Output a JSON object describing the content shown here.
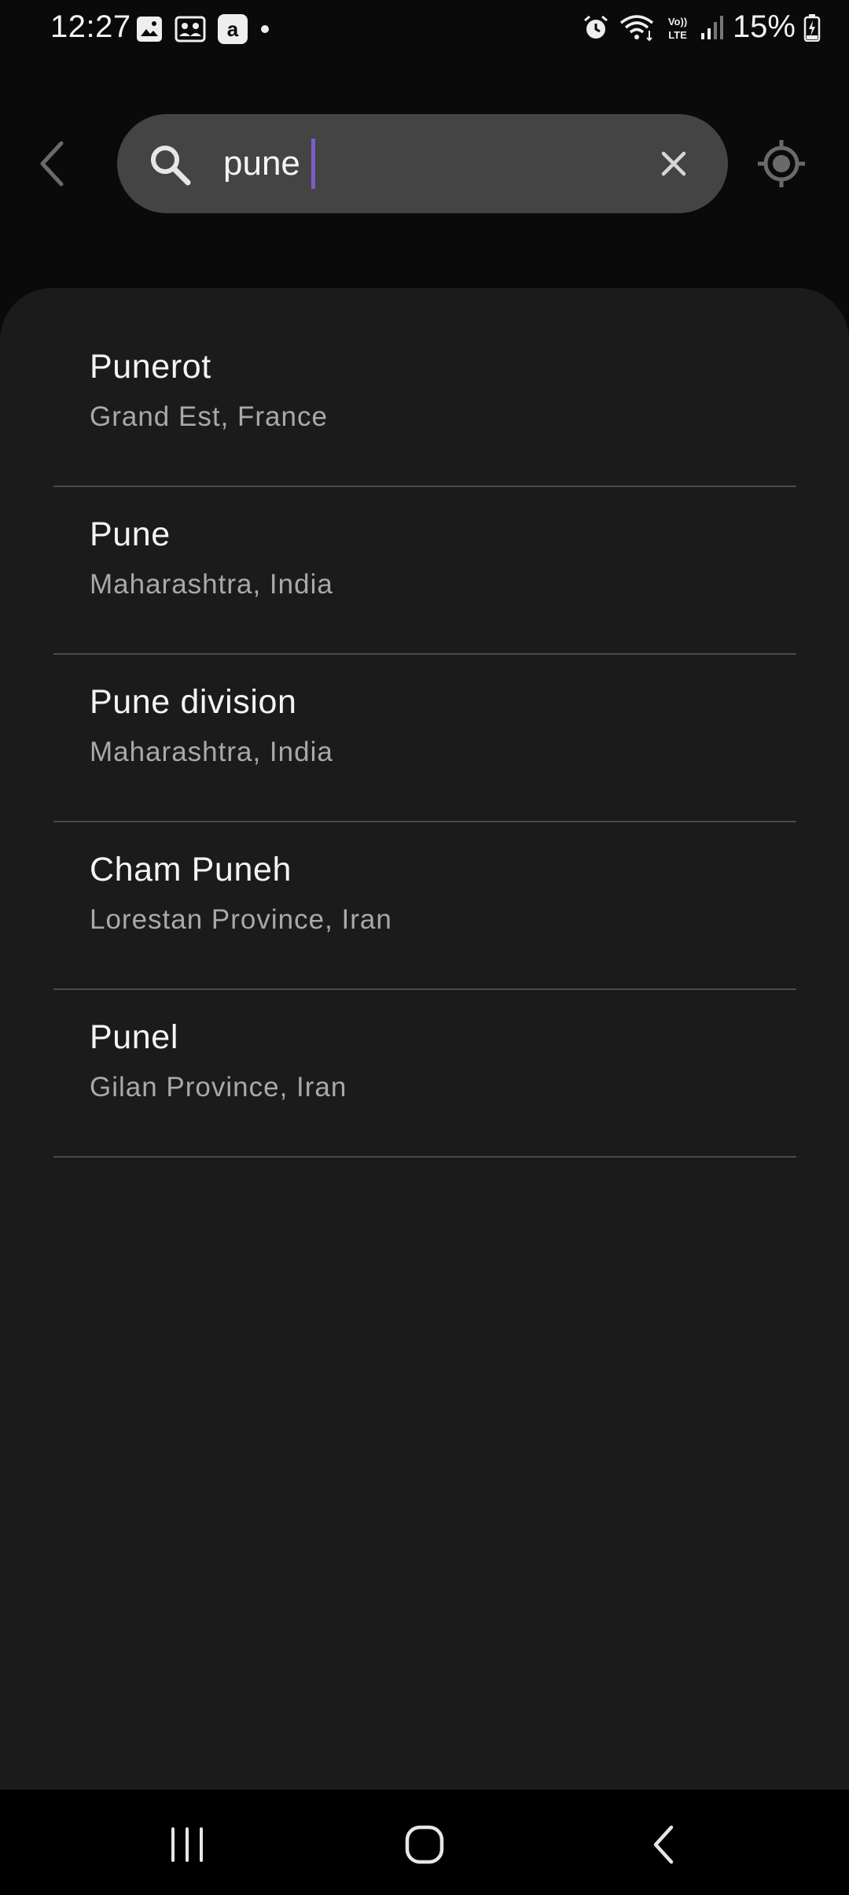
{
  "status_bar": {
    "time": "12:27",
    "left_icons": [
      "gallery-icon",
      "contacts-card-icon",
      "amazon-icon",
      "notification-dot-icon"
    ],
    "right_icons": [
      "alarm-icon",
      "wifi-icon",
      "volte-icon",
      "signal-icon"
    ],
    "battery_percent": "15%",
    "battery_icon": "battery-charging-icon"
  },
  "search": {
    "query": "pune",
    "caret_color": "#7b5cc9",
    "icons": {
      "back": "back-arrow-icon",
      "search": "search-icon",
      "clear": "close-icon",
      "locate": "my-location-icon"
    }
  },
  "results": [
    {
      "name": "Punerot",
      "region": "Grand Est, France"
    },
    {
      "name": "Pune",
      "region": "Maharashtra, India"
    },
    {
      "name": "Pune division",
      "region": "Maharashtra, India"
    },
    {
      "name": "Cham Puneh",
      "region": "Lorestan Province, Iran"
    },
    {
      "name": "Punel",
      "region": "Gilan Province, Iran"
    }
  ],
  "nav_bar": {
    "icons": [
      "recents-icon",
      "home-icon",
      "back-icon"
    ]
  },
  "colors": {
    "background": "#0a0a0a",
    "sheet": "#1b1b1b",
    "search_bar": "#444444",
    "divider": "#4a4a4a",
    "primary_text": "#f4f4f4",
    "secondary_text": "#a9a9a9",
    "accent": "#7b5cc9"
  }
}
